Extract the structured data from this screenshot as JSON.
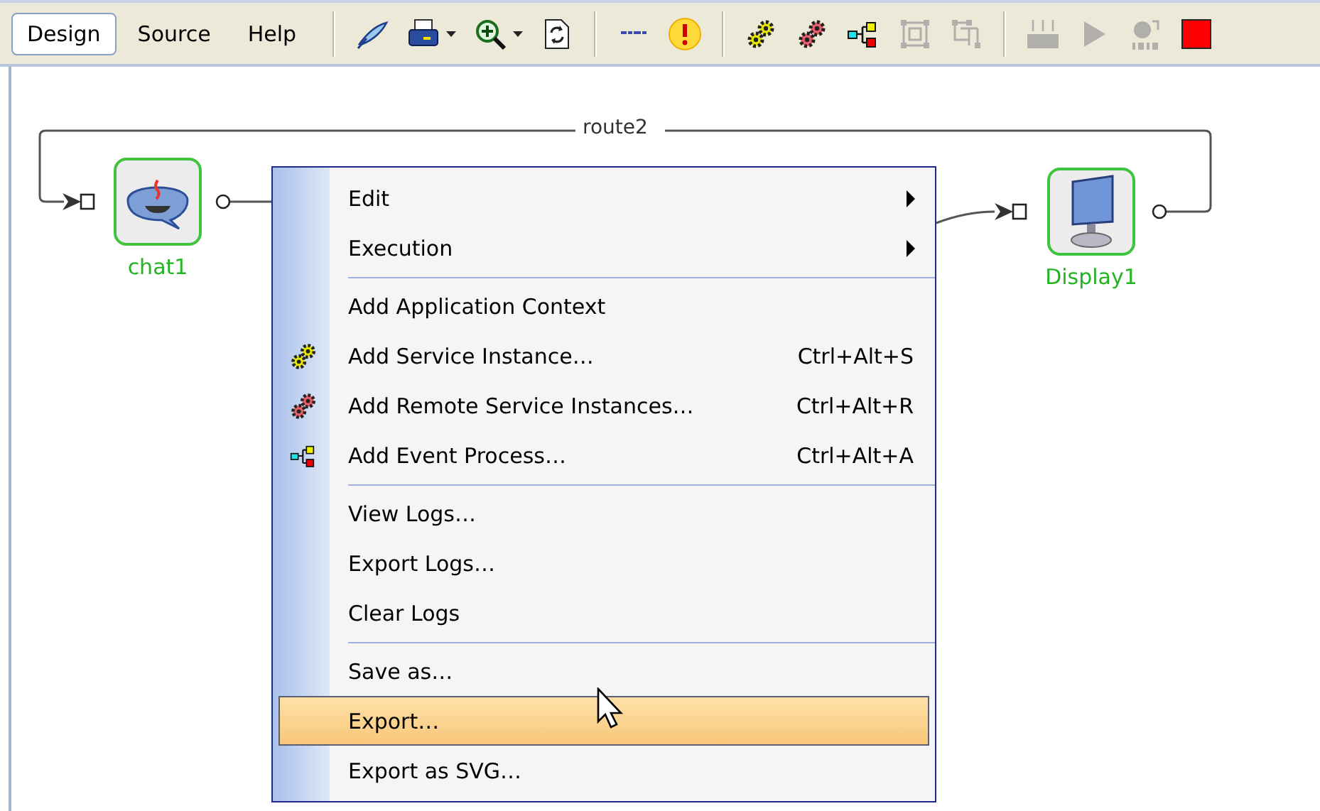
{
  "toolbar": {
    "tabs": [
      {
        "label": "Design",
        "selected": true
      },
      {
        "label": "Source",
        "selected": false
      },
      {
        "label": "Help",
        "selected": false
      }
    ],
    "tool_groups": [
      {
        "tools": [
          {
            "kind": "feather",
            "disabled": false
          },
          {
            "kind": "printer",
            "disabled": false
          },
          {
            "kind": "zoom",
            "disabled": false
          },
          {
            "kind": "refresh",
            "disabled": false
          }
        ]
      },
      {
        "tools": [
          {
            "kind": "label",
            "disabled": false
          },
          {
            "kind": "warning",
            "disabled": false
          }
        ]
      },
      {
        "tools": [
          {
            "kind": "gears",
            "color": "#e6e600",
            "disabled": false
          },
          {
            "kind": "gears",
            "color": "#e8606a",
            "disabled": false
          },
          {
            "kind": "event",
            "disabled": false
          },
          {
            "kind": "group",
            "disabled": true
          },
          {
            "kind": "ungroup",
            "disabled": true
          }
        ]
      },
      {
        "tools": [
          {
            "kind": "keyboard",
            "disabled": true
          },
          {
            "kind": "play",
            "disabled": true
          },
          {
            "kind": "deploy",
            "disabled": true
          },
          {
            "kind": "stop",
            "disabled": false
          }
        ]
      }
    ]
  },
  "canvas": {
    "route_label": "route2",
    "nodes": [
      {
        "label": "chat1",
        "kind": "chat"
      },
      {
        "label": "Display1",
        "kind": "display"
      }
    ]
  },
  "context_menu": {
    "items": [
      {
        "kind": "submenu",
        "label": "Edit",
        "selected": false
      },
      {
        "kind": "submenu",
        "label": "Execution",
        "selected": false
      },
      {
        "kind": "separator"
      },
      {
        "kind": "text",
        "label": "Add Application Context",
        "selected": false
      },
      {
        "kind": "gears",
        "label": "Add Service Instance…",
        "shortcut": "Ctrl+Alt+S",
        "color": "#e6e600",
        "selected": false
      },
      {
        "kind": "gears",
        "label": "Add Remote Service Instances…",
        "shortcut": "Ctrl+Alt+R",
        "color": "#e8606a",
        "selected": false
      },
      {
        "kind": "flow",
        "label": "Add Event Process…",
        "shortcut": "Ctrl+Alt+A",
        "selected": false
      },
      {
        "kind": "separator"
      },
      {
        "kind": "text",
        "label": "View Logs…",
        "selected": false
      },
      {
        "kind": "text",
        "label": "Export Logs…",
        "selected": false
      },
      {
        "kind": "text",
        "label": "Clear Logs",
        "selected": false
      },
      {
        "kind": "separator"
      },
      {
        "kind": "text",
        "label": "Save as…",
        "selected": false
      },
      {
        "kind": "text",
        "label": "Export…",
        "selected": true
      },
      {
        "kind": "text",
        "label": "Export as SVG…",
        "selected": false
      }
    ]
  }
}
